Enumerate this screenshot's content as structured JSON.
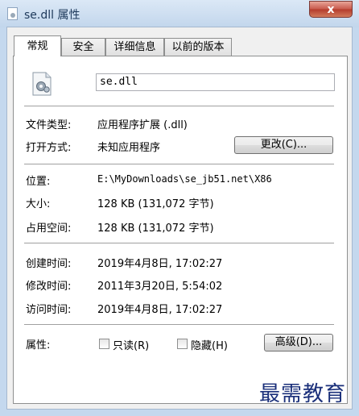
{
  "window": {
    "title": "se.dll 属性",
    "close_label": "x"
  },
  "tabs": [
    "常规",
    "安全",
    "详细信息",
    "以前的版本"
  ],
  "file": {
    "name": "se.dll"
  },
  "type_section": {
    "type_label": "文件类型:",
    "type_value": "应用程序扩展 (.dll)",
    "open_label": "打开方式:",
    "open_value": "未知应用程序",
    "change_button": "更改(C)..."
  },
  "location_section": {
    "location_label": "位置:",
    "location_value": "E:\\MyDownloads\\se_jb51.net\\X86",
    "size_label": "大小:",
    "size_value": "128 KB (131,072 字节)",
    "disk_label": "占用空间:",
    "disk_value": "128 KB (131,072 字节)"
  },
  "time_section": {
    "created_label": "创建时间:",
    "created_value": "2019年4月8日, 17:02:27",
    "modified_label": "修改时间:",
    "modified_value": "2011年3月20日, 5:54:02",
    "accessed_label": "访问时间:",
    "accessed_value": "2019年4月8日, 17:02:27"
  },
  "attributes": {
    "label": "属性:",
    "readonly_label": "只读(R)",
    "readonly_checked": false,
    "hidden_label": "隐藏(H)",
    "hidden_checked": false,
    "advanced_button": "高级(D)..."
  },
  "watermark": "最需教育"
}
